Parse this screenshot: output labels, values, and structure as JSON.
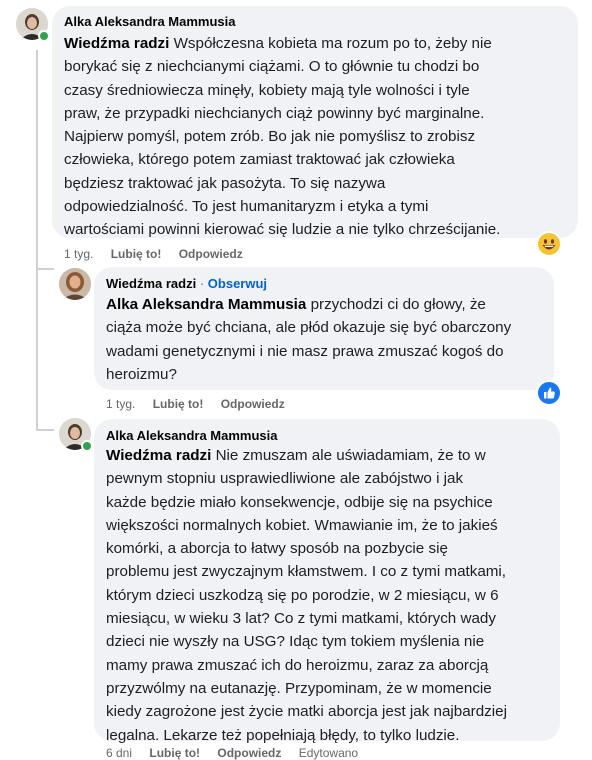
{
  "comments": [
    {
      "author": "Alka Aleksandra Mammusia",
      "mention": "Wiedźma radzi",
      "lines": [
        " Współczesna kobieta ma rozum po to, żeby nie",
        "borykać się z niechcianymi ciążami. O to głównie tu chodzi bo",
        "czasy średniowiecza minęły, kobiety mają tyle wolności i tyle",
        "praw, że przypadki niechcianych ciąż powinny być marginalne.",
        "Najpierw pomyśl, potem zrób. Bo jak nie pomyślisz to zrobisz",
        "człowieka, którego potem zamiast traktować jak człowieka",
        "będziesz traktować jak pasożyta. To się nazywa",
        "odpowiedzialność. To jest humanitaryzm i etyka a tymi",
        "wartościami powinni kierować się ludzie a nie tylko chrześcijanie."
      ],
      "time": "1 tyg.",
      "like": "Lubię to!",
      "reply": "Odpowiedz",
      "reaction_icon": "grinning-face-icon"
    },
    {
      "author": "Wiedźma radzi",
      "separator": "·",
      "follow": "Obserwuj",
      "mention": "Alka Aleksandra Mammusia",
      "lines": [
        " przychodzi ci do głowy, że",
        "ciąża może być chciana, ale płód okazuje się być obarczony",
        "wadami genetycznymi i nie masz prawa zmuszać kogoś do",
        "heroizmu?"
      ],
      "time": "1 tyg.",
      "like": "Lubię to!",
      "reply": "Odpowiedz",
      "reaction_icon": "thumbs-up-icon",
      "accent": "#1877f2"
    },
    {
      "author": "Alka Aleksandra Mammusia",
      "mention": "Wiedźma radzi",
      "lines": [
        " Nie zmuszam ale uświadamiam, że to w",
        "pewnym stopniu usprawiedliwione ale zabójstwo i jak",
        "każde będzie miało konsekwencje, odbije się na psychice",
        "większości normalnych kobiet. Wmawianie im, że to jakieś",
        "komórki, a aborcja to łatwy sposób na pozbycie się",
        "problemu jest zwyczajnym kłamstwem. I co z tymi matkami,",
        "którym dzieci uszkodzą się po porodzie, w 2 miesiącu, w 6",
        "miesiącu, w wieku 3 lat? Co z tymi matkami, których wady",
        "dzieci nie wyszły na USG? Idąc tym tokiem myślenia nie",
        "mamy prawa zmuszać ich do heroizmu, zaraz za aborcją",
        "przyzwólmy na eutanazję. Przypominam, że w momencie",
        "kiedy zagrożone jest życie matki aborcja jest jak najbardziej",
        "legalna. Lekarze też popełniają błędy, to tylko ludzie."
      ],
      "time": "6 dni",
      "like": "Lubię to!",
      "reply": "Odpowiedz",
      "edited": "Edytowano"
    }
  ],
  "colors": {
    "bubble": "#f0f2f5",
    "online": "#31a24c",
    "link": "#0064d1",
    "meta": "#65676b"
  }
}
